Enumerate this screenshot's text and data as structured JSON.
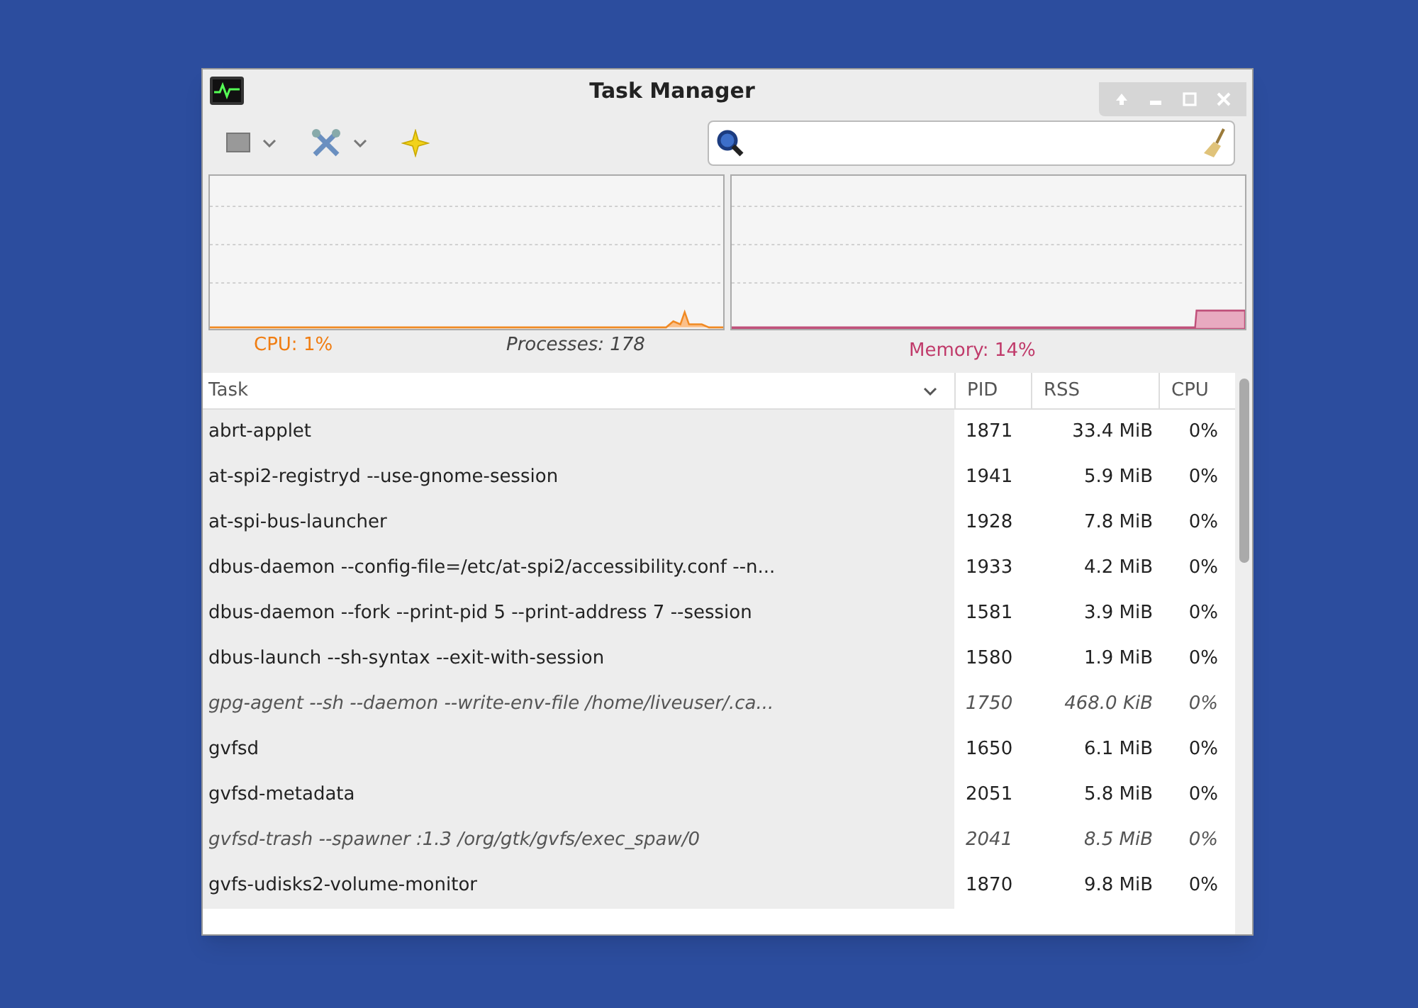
{
  "window": {
    "title": "Task Manager"
  },
  "status": {
    "cpu": "CPU: 1%",
    "processes": "Processes: 178",
    "memory": "Memory: 14%"
  },
  "table": {
    "columns": [
      "Task",
      "PID",
      "RSS",
      "CPU"
    ],
    "rows": [
      {
        "task": "abrt-applet",
        "pid": "1871",
        "rss": "33.4 MiB",
        "cpu": "0%",
        "italic": false
      },
      {
        "task": "at-spi2-registryd --use-gnome-session",
        "pid": "1941",
        "rss": "5.9 MiB",
        "cpu": "0%",
        "italic": false
      },
      {
        "task": "at-spi-bus-launcher",
        "pid": "1928",
        "rss": "7.8 MiB",
        "cpu": "0%",
        "italic": false
      },
      {
        "task": "dbus-daemon --config-file=/etc/at-spi2/accessibility.conf --n...",
        "pid": "1933",
        "rss": "4.2 MiB",
        "cpu": "0%",
        "italic": false
      },
      {
        "task": "dbus-daemon --fork --print-pid 5 --print-address 7 --session",
        "pid": "1581",
        "rss": "3.9 MiB",
        "cpu": "0%",
        "italic": false
      },
      {
        "task": "dbus-launch --sh-syntax --exit-with-session",
        "pid": "1580",
        "rss": "1.9 MiB",
        "cpu": "0%",
        "italic": false
      },
      {
        "task": "gpg-agent --sh --daemon --write-env-file /home/liveuser/.ca...",
        "pid": "1750",
        "rss": "468.0 KiB",
        "cpu": "0%",
        "italic": true
      },
      {
        "task": "gvfsd",
        "pid": "1650",
        "rss": "6.1 MiB",
        "cpu": "0%",
        "italic": false
      },
      {
        "task": "gvfsd-metadata",
        "pid": "2051",
        "rss": "5.8 MiB",
        "cpu": "0%",
        "italic": false
      },
      {
        "task": "gvfsd-trash --spawner :1.3 /org/gtk/gvfs/exec_spaw/0",
        "pid": "2041",
        "rss": "8.5 MiB",
        "cpu": "0%",
        "italic": true
      },
      {
        "task": "gvfs-udisks2-volume-monitor",
        "pid": "1870",
        "rss": "9.8 MiB",
        "cpu": "0%",
        "italic": false
      }
    ]
  }
}
